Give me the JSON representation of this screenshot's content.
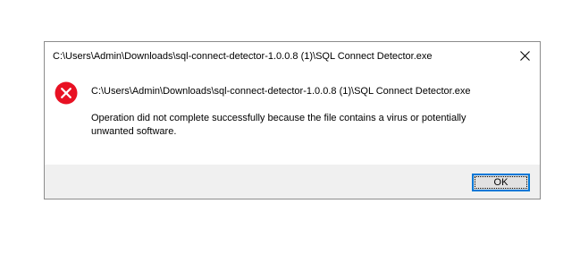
{
  "dialog": {
    "title": "C:\\Users\\Admin\\Downloads\\sql-connect-detector-1.0.0.8 (1)\\SQL Connect Detector.exe",
    "close_icon": "close-icon",
    "error_icon": "error-icon",
    "error_icon_color": "#e81123",
    "message_path": "C:\\Users\\Admin\\Downloads\\sql-connect-detector-1.0.0.8 (1)\\SQL Connect Detector.exe",
    "message_body": "Operation did not complete successfully because the file contains a virus or potentially unwanted software.",
    "ok_label": "OK",
    "accent_color": "#0078d7"
  }
}
